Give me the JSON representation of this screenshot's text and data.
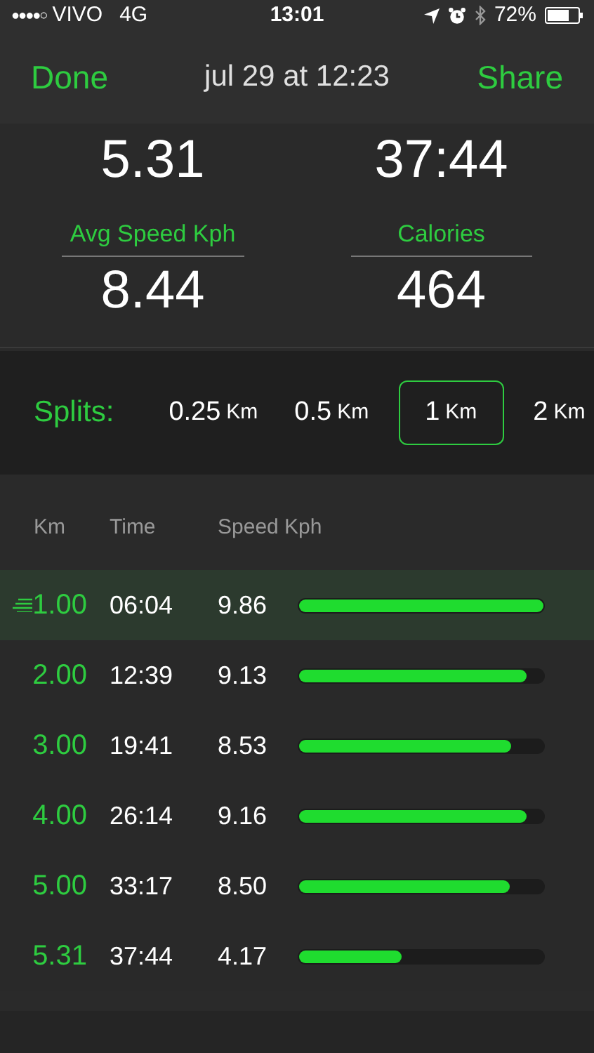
{
  "status_bar": {
    "signal": "●●●●○",
    "carrier": "VIVO",
    "network": "4G",
    "time": "13:01",
    "battery": "72%"
  },
  "nav": {
    "left": "Done",
    "title": "jul 29 at 12:23",
    "right": "Share"
  },
  "stats": [
    {
      "value": "5.31"
    },
    {
      "value": "37:44"
    },
    {
      "label": "Avg Speed Kph",
      "value": "8.44"
    },
    {
      "label": "Calories",
      "value": "464"
    }
  ],
  "splits": {
    "label": "Splits:",
    "options": [
      {
        "value": "0.25",
        "unit": "Km",
        "selected": false
      },
      {
        "value": "0.5",
        "unit": "Km",
        "selected": false
      },
      {
        "value": "1",
        "unit": "Km",
        "selected": true
      },
      {
        "value": "2",
        "unit": "Km",
        "selected": false
      }
    ]
  },
  "table": {
    "columns": [
      "Km",
      "Time",
      "Speed Kph"
    ],
    "rows": [
      {
        "km": "1.00",
        "time": "06:04",
        "speed": "9.86",
        "level": 1.0,
        "selected": true
      },
      {
        "km": "2.00",
        "time": "12:39",
        "speed": "9.13",
        "level": 0.93,
        "selected": false
      },
      {
        "km": "3.00",
        "time": "19:41",
        "speed": "8.53",
        "level": 0.87,
        "selected": false
      },
      {
        "km": "4.00",
        "time": "26:14",
        "speed": "9.16",
        "level": 0.93,
        "selected": false
      },
      {
        "km": "5.00",
        "time": "33:17",
        "speed": "8.50",
        "level": 0.86,
        "selected": false
      },
      {
        "km": "5.31",
        "time": "37:44",
        "speed": "4.17",
        "level": 0.42,
        "selected": false
      }
    ]
  }
}
